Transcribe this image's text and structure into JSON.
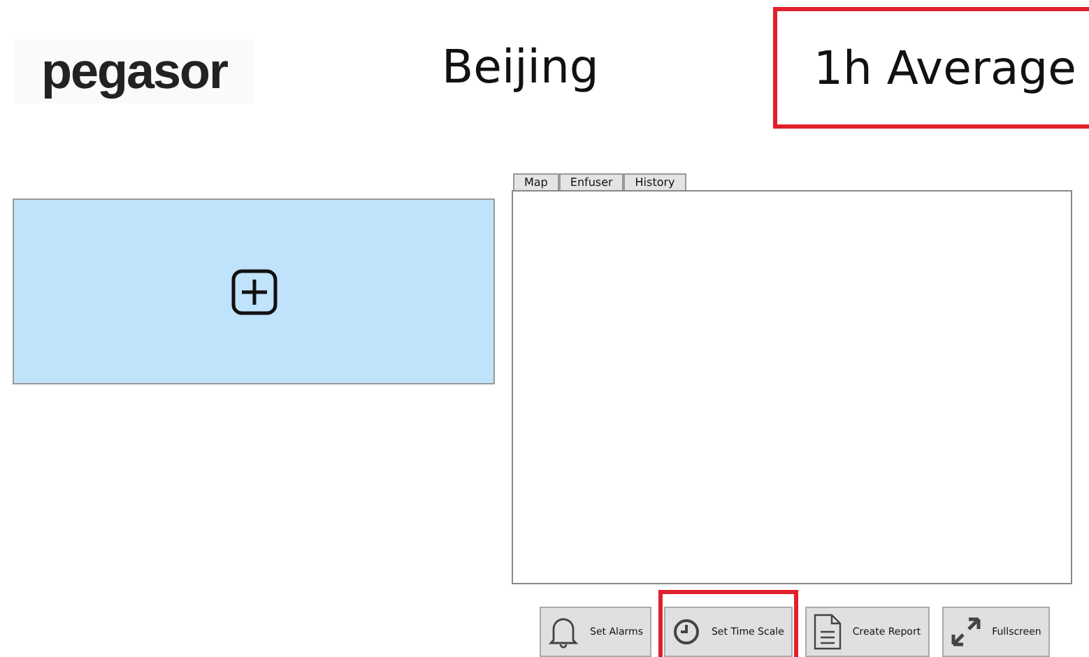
{
  "header": {
    "logo": "pegasor",
    "city": "Beijing",
    "period": {
      "label": "1h Average",
      "highlighted": true
    }
  },
  "add_panel": {
    "kind": "add"
  },
  "tabs": [
    {
      "label": "Map",
      "selected": false
    },
    {
      "label": "Enfuser",
      "selected": false
    },
    {
      "label": "History",
      "selected": false
    }
  ],
  "buttons": [
    {
      "label": "Set Alarms",
      "kind": "bell",
      "highlighted": false
    },
    {
      "label": "Set Time Scale",
      "kind": "clock",
      "highlighted": true
    },
    {
      "label": "Create Report",
      "kind": "document",
      "highlighted": false
    },
    {
      "label": "Fullscreen",
      "kind": "expand",
      "highlighted": false
    }
  ]
}
